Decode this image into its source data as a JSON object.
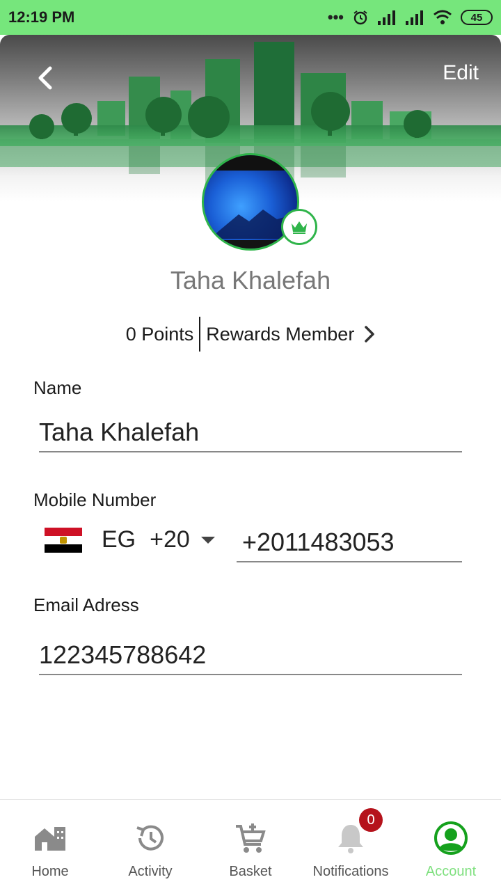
{
  "status_bar": {
    "time": "12:19 PM",
    "battery": "45"
  },
  "header": {
    "edit_label": "Edit"
  },
  "profile": {
    "name": "Taha Khalefah",
    "points": "0 Points",
    "membership": "Rewards Member"
  },
  "form": {
    "name_label": "Name",
    "name_value": "Taha Khalefah",
    "mobile_label": "Mobile Number",
    "country_code": "EG",
    "dial_code": "+20",
    "mobile_value": "+2011483053",
    "email_label": "Email Adress",
    "email_value": "122345788642"
  },
  "nav": {
    "items": [
      {
        "label": "Home",
        "icon": "home-icon"
      },
      {
        "label": "Activity",
        "icon": "history-icon"
      },
      {
        "label": "Basket",
        "icon": "cart-icon"
      },
      {
        "label": "Notifications",
        "icon": "bell-icon",
        "badge": "0"
      },
      {
        "label": "Account",
        "icon": "account-icon"
      }
    ]
  },
  "colors": {
    "status_bar": "#76e67c",
    "accent": "#2fb44a",
    "active_nav": "#7fe07f",
    "badge": "#b5121b"
  }
}
